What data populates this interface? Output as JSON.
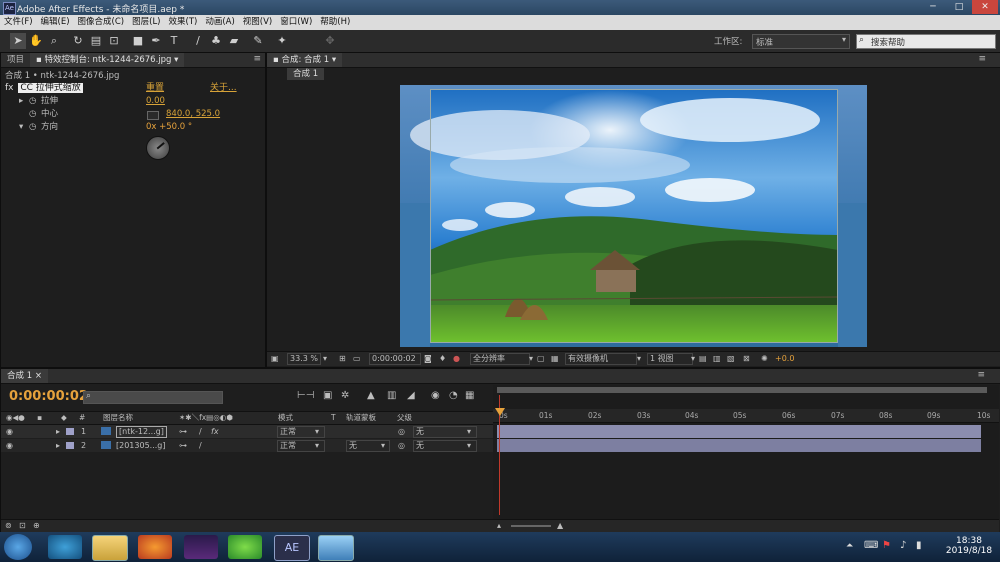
{
  "app": {
    "title": "Adobe After Effects - 未命名项目.aep *",
    "logo": "Ae"
  },
  "menu": [
    "文件(F)",
    "编辑(E)",
    "图像合成(C)",
    "图层(L)",
    "效果(T)",
    "动画(A)",
    "视图(V)",
    "窗口(W)",
    "帮助(H)"
  ],
  "toolbar": {
    "workspace_label": "工作区:",
    "workspace_value": "标准",
    "search_placeholder": "搜索帮助"
  },
  "left_panel": {
    "tabs": [
      "项目",
      "特效控制台: ntk-1244-2676.jpg"
    ],
    "breadcrumb": "合成 1 • ntk-1244-2676.jpg",
    "effect": {
      "fx": "fx",
      "name": "CC 拉伸式缩放",
      "reset": "重置",
      "about": "关于..."
    },
    "props": [
      {
        "label": "拉伸",
        "value": "0.00"
      },
      {
        "label": "中心",
        "value": "840.0, 525.0"
      },
      {
        "label": "方向",
        "value": "0x +50.0 °"
      }
    ]
  },
  "viewer": {
    "tab": "合成: 合成 1",
    "subtab": "合成 1",
    "zoom": "33.3 %",
    "timecode": "0:00:00:02",
    "resolution": "全分辨率",
    "camera": "有效摄像机",
    "views": "1 视图",
    "exposure": "+0.0"
  },
  "timeline": {
    "tab": "合成 1",
    "current_time": "0:00:00:02",
    "columns": {
      "num": "#",
      "name": "图层名称",
      "mode": "模式",
      "t": "T",
      "trkmat": "轨道蒙板",
      "parent": "父级"
    },
    "layers": [
      {
        "num": "1",
        "name": "[ntk-12...g]",
        "mode": "正常",
        "trkmat": "",
        "parent": "无"
      },
      {
        "num": "2",
        "name": "[201305...g]",
        "mode": "正常",
        "trkmat": "无",
        "parent": "无"
      }
    ],
    "ruler": [
      "0s",
      "01s",
      "02s",
      "03s",
      "04s",
      "05s",
      "06s",
      "07s",
      "08s",
      "09s",
      "10s"
    ]
  },
  "taskbar": {
    "time": "18:38",
    "date": "2019/8/18",
    "ae_label": "AE"
  },
  "colors": {
    "accent": "#e6a23c",
    "playhead": "#c0392b",
    "layer_bar": "#9fa1c9"
  }
}
